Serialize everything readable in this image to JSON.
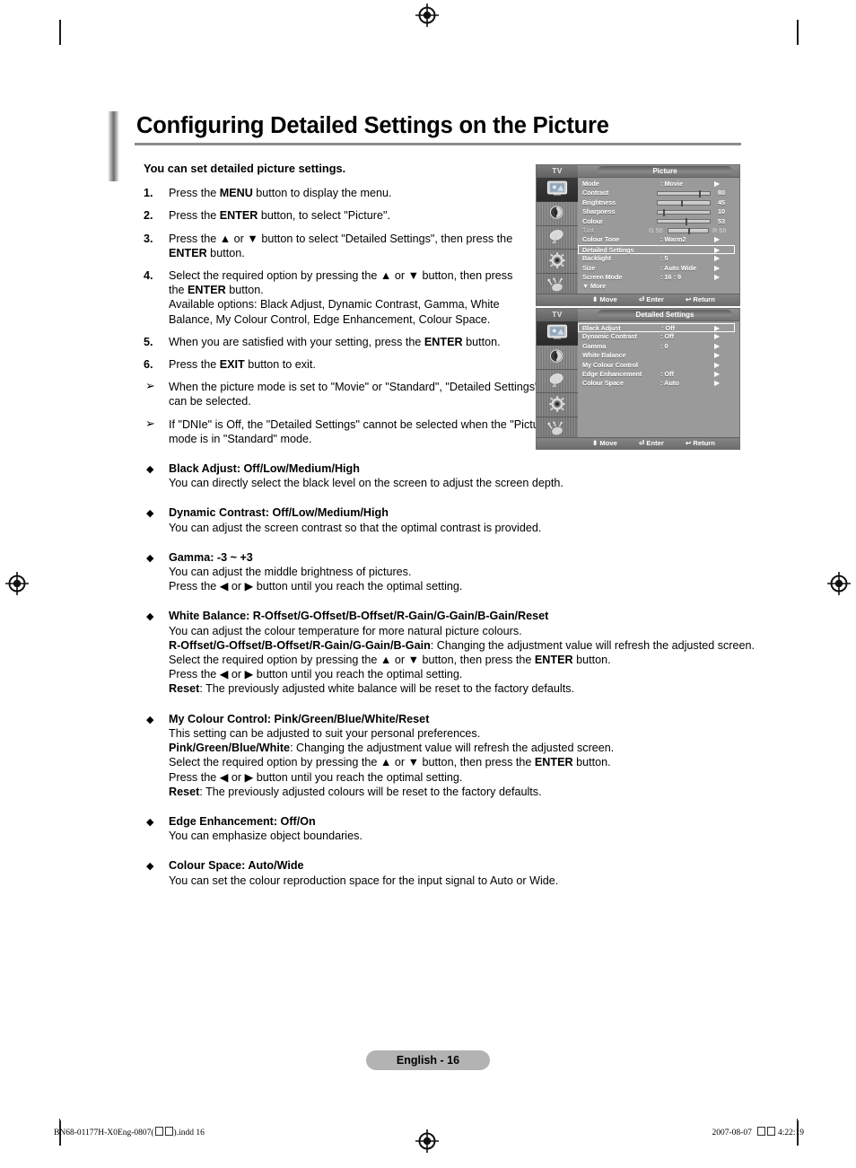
{
  "page": {
    "title": "Configuring Detailed Settings on the Picture",
    "lead": "You can set detailed picture settings.",
    "page_label": "English - 16"
  },
  "footer": {
    "file": "BN68-01177H-X0Eng-0807(",
    "file_tail": ").indd   16",
    "date": "2007-08-07",
    "time": "4:22:19"
  },
  "steps": [
    {
      "num": "1.",
      "parts": [
        {
          "t": "Press the ",
          "b": false
        },
        {
          "t": "MENU",
          "b": true
        },
        {
          "t": " button to display the menu.",
          "b": false
        }
      ]
    },
    {
      "num": "2.",
      "parts": [
        {
          "t": "Press the ",
          "b": false
        },
        {
          "t": "ENTER",
          "b": true
        },
        {
          "t": " button, to select \"Picture\".",
          "b": false
        }
      ]
    },
    {
      "num": "3.",
      "parts": [
        {
          "t": "Press the ▲ or ▼ button to select \"Detailed Settings\", then press the ",
          "b": false
        },
        {
          "t": "ENTER",
          "b": true
        },
        {
          "t": " button.",
          "b": false
        }
      ]
    },
    {
      "num": "4.",
      "parts": [
        {
          "t": "Select the required option by pressing the ▲ or ▼ button, then press the ",
          "b": false
        },
        {
          "t": "ENTER",
          "b": true
        },
        {
          "t": " button.",
          "b": false
        },
        {
          "t": "\nAvailable options: Black Adjust, Dynamic Contrast, Gamma, White Balance, My Colour Control, Edge Enhancement, Colour Space.",
          "b": false
        }
      ]
    },
    {
      "num": "5.",
      "parts": [
        {
          "t": "When you are satisfied with your setting, press the ",
          "b": false
        },
        {
          "t": "ENTER",
          "b": true
        },
        {
          "t": " button.",
          "b": false
        }
      ]
    },
    {
      "num": "6.",
      "parts": [
        {
          "t": "Press the ",
          "b": false
        },
        {
          "t": "EXIT",
          "b": true
        },
        {
          "t": " button to exit.",
          "b": false
        }
      ]
    }
  ],
  "notes": [
    {
      "mark": "➢",
      "text": "When the picture mode is set to \"Movie\" or \"Standard\", \"Detailed Settings\" can be selected."
    },
    {
      "mark": "➢",
      "text": "If \"DNIe\" is Off, the \"Detailed Settings\" cannot be selected when the \"Picture\" mode is in \"Standard\" mode."
    }
  ],
  "bullets": [
    {
      "mark": "◆",
      "head": "Black Adjust: Off/Low/Medium/High",
      "lines": [
        [
          {
            "t": "You can directly select the black level on the screen to adjust the screen depth.",
            "b": false
          }
        ]
      ]
    },
    {
      "mark": "◆",
      "head": "Dynamic Contrast: Off/Low/Medium/High",
      "lines": [
        [
          {
            "t": "You can adjust the screen contrast so that the optimal contrast is provided.",
            "b": false
          }
        ]
      ]
    },
    {
      "mark": "◆",
      "head": "Gamma: -3 ~ +3",
      "lines": [
        [
          {
            "t": "You can adjust the middle brightness of pictures.",
            "b": false
          }
        ],
        [
          {
            "t": "Press the ◀ or ▶ button until you reach the optimal setting.",
            "b": false
          }
        ]
      ]
    },
    {
      "mark": "◆",
      "head": "White Balance: R-Offset/G-Offset/B-Offset/R-Gain/G-Gain/B-Gain/Reset",
      "lines": [
        [
          {
            "t": "You can adjust the colour temperature for more natural picture colours.",
            "b": false
          }
        ],
        [
          {
            "t": "R-Offset/G-Offset/B-Offset/R-Gain/G-Gain/B-Gain",
            "b": true
          },
          {
            "t": ": Changing the adjustment value will refresh the adjusted screen.",
            "b": false
          }
        ],
        [
          {
            "t": "Select the required option by pressing the ▲ or ▼ button, then press the ",
            "b": false
          },
          {
            "t": "ENTER",
            "b": true
          },
          {
            "t": " button.",
            "b": false
          }
        ],
        [
          {
            "t": "Press the ◀ or ▶ button until you reach the optimal setting.",
            "b": false
          }
        ],
        [
          {
            "t": "Reset",
            "b": true
          },
          {
            "t": ": The previously adjusted white balance will be reset to the factory defaults.",
            "b": false
          }
        ]
      ]
    },
    {
      "mark": "◆",
      "head": "My Colour Control: Pink/Green/Blue/White/Reset",
      "lines": [
        [
          {
            "t": "This setting can be adjusted to suit your personal preferences.",
            "b": false
          }
        ],
        [
          {
            "t": "Pink/Green/Blue/White",
            "b": true
          },
          {
            "t": ": Changing the adjustment value will refresh the adjusted screen.",
            "b": false
          }
        ],
        [
          {
            "t": "Select the required option by pressing the ▲ or ▼ button, then press the ",
            "b": false
          },
          {
            "t": "ENTER",
            "b": true
          },
          {
            "t": " button.",
            "b": false
          }
        ],
        [
          {
            "t": "Press the ◀ or ▶ button until you reach the optimal setting.",
            "b": false
          }
        ],
        [
          {
            "t": "Reset",
            "b": true
          },
          {
            "t": ": The previously adjusted colours will be reset to the factory defaults.",
            "b": false
          }
        ]
      ]
    },
    {
      "mark": "◆",
      "head": "Edge Enhancement: Off/On",
      "lines": [
        [
          {
            "t": "You can emphasize object boundaries.",
            "b": false
          }
        ]
      ]
    },
    {
      "mark": "◆",
      "head": "Colour Space: Auto/Wide",
      "lines": [
        [
          {
            "t": "You can set the colour reproduction space for the input signal to Auto or Wide.",
            "b": false
          }
        ]
      ]
    }
  ],
  "osd": {
    "source_label": "TV",
    "hints": {
      "move": "Move",
      "enter": "Enter",
      "return": "Return",
      "move_icon": "updown-arrow-icon",
      "enter_icon": "enter-key-icon",
      "return_icon": "return-arrow-icon"
    },
    "rail_icons": [
      "picture-icon",
      "sound-icon",
      "channel-dish-icon",
      "setup-gear-icon",
      "input-icon"
    ],
    "picture_menu": {
      "title": "Picture",
      "rows": [
        {
          "label": "Mode",
          "value": ": Movie",
          "kind": "value",
          "arrow": "▶",
          "selected": false,
          "dim": false
        },
        {
          "label": "Contrast",
          "kind": "slider",
          "percent": 80,
          "num": "80",
          "selected": false,
          "dim": false
        },
        {
          "label": "Brightness",
          "kind": "slider",
          "percent": 45,
          "num": "45",
          "selected": false,
          "dim": false
        },
        {
          "label": "Sharpness",
          "kind": "slider",
          "percent": 10,
          "num": "10",
          "selected": false,
          "dim": false
        },
        {
          "label": "Colour",
          "kind": "slider",
          "percent": 53,
          "num": "53",
          "selected": false,
          "dim": false
        },
        {
          "label": "Tint",
          "kind": "tint",
          "left": "G 50",
          "right": "R 50",
          "percent": 50,
          "selected": false,
          "dim": true
        },
        {
          "label": "Colour Tone",
          "value": ": Warm2",
          "kind": "value",
          "arrow": "▶",
          "selected": false,
          "dim": false
        },
        {
          "label": "Detailed Settings",
          "value": "",
          "kind": "value",
          "arrow": "▶",
          "selected": true,
          "dim": false
        },
        {
          "label": "Backlight",
          "value": ": 5",
          "kind": "value",
          "arrow": "▶",
          "selected": false,
          "dim": false
        },
        {
          "label": "Size",
          "value": ": Auto Wide",
          "kind": "value",
          "arrow": "▶",
          "selected": false,
          "dim": false
        },
        {
          "label": "Screen Mode",
          "value": ": 16 : 9",
          "kind": "value",
          "arrow": "▶",
          "selected": false,
          "dim": false
        },
        {
          "label": "▼ More",
          "value": "",
          "kind": "plain",
          "arrow": "",
          "selected": false,
          "dim": false
        }
      ]
    },
    "detailed_menu": {
      "title": "Detailed Settings",
      "rows": [
        {
          "label": "Black Adjust",
          "value": ": Off",
          "kind": "value",
          "arrow": "▶",
          "selected": true,
          "dim": false
        },
        {
          "label": "Dynamic Contrast",
          "value": ": Off",
          "kind": "value",
          "arrow": "▶",
          "selected": false,
          "dim": false
        },
        {
          "label": "Gamma",
          "value": ": 0",
          "kind": "value",
          "arrow": "▶",
          "selected": false,
          "dim": false
        },
        {
          "label": "White Balance",
          "value": "",
          "kind": "value",
          "arrow": "▶",
          "selected": false,
          "dim": false
        },
        {
          "label": "My Colour Control",
          "value": "",
          "kind": "value",
          "arrow": "▶",
          "selected": false,
          "dim": false
        },
        {
          "label": "Edge Enhancement",
          "value": ": Off",
          "kind": "value",
          "arrow": "▶",
          "selected": false,
          "dim": false
        },
        {
          "label": "Colour Space",
          "value": ": Auto",
          "kind": "value",
          "arrow": "▶",
          "selected": false,
          "dim": false
        }
      ]
    }
  }
}
